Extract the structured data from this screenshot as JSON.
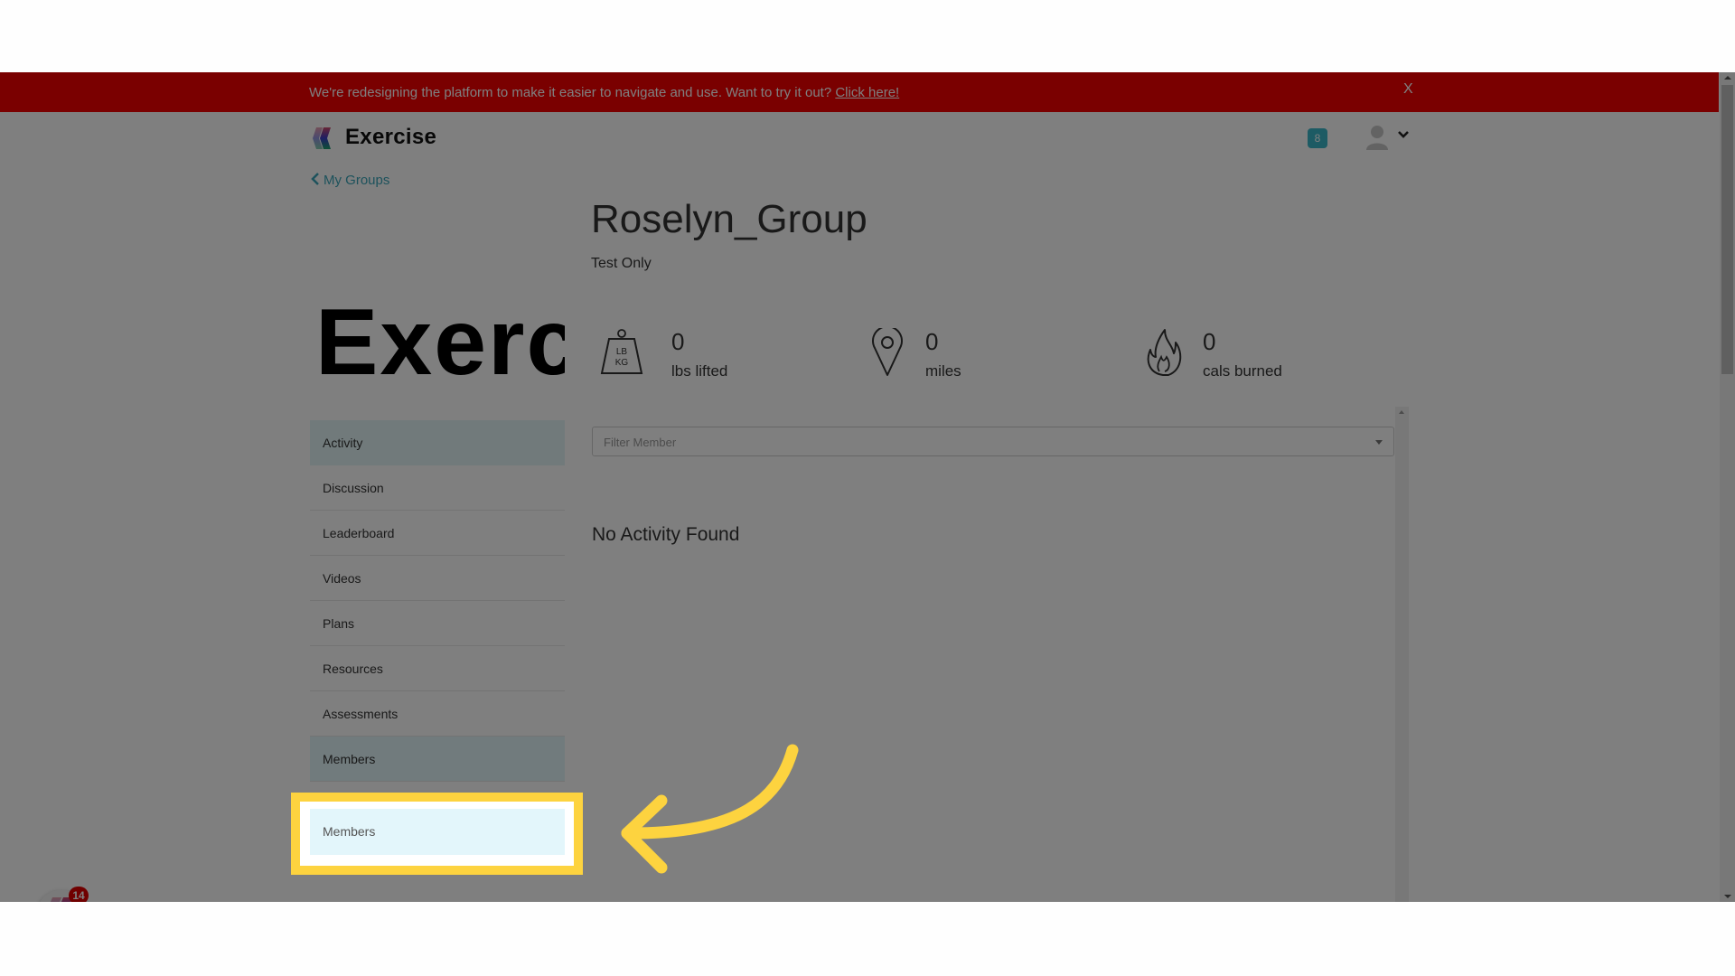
{
  "banner": {
    "message": "We're redesigning the platform to make it easier to navigate and use. Want to try it out?",
    "link_label": "Click here!",
    "close_label": "X",
    "color": "#f40000"
  },
  "header": {
    "brand": "Exercise",
    "notification_count": "8",
    "accent": "#3bb6c9"
  },
  "back_link": {
    "label": "My Groups",
    "icon": "chevron-left-icon"
  },
  "group": {
    "image_text": "Exerc",
    "title": "Roselyn_Group",
    "subtitle": "Test Only"
  },
  "stats": [
    {
      "icon": "weight-icon",
      "icon_text_top": "LB",
      "icon_text_bottom": "KG",
      "value": "0",
      "label": "lbs lifted"
    },
    {
      "icon": "location-pin-icon",
      "value": "0",
      "label": "miles"
    },
    {
      "icon": "flame-icon",
      "value": "0",
      "label": "cals burned"
    }
  ],
  "sidebar": {
    "items": [
      {
        "label": "Activity",
        "active": true
      },
      {
        "label": "Discussion"
      },
      {
        "label": "Leaderboard"
      },
      {
        "label": "Videos"
      },
      {
        "label": "Plans"
      },
      {
        "label": "Resources"
      },
      {
        "label": "Assessments"
      },
      {
        "label": "Members",
        "highlighted": true
      }
    ]
  },
  "filter": {
    "placeholder": "Filter Member"
  },
  "empty_state": "No Activity Found",
  "chat_widget": {
    "badge_count": "14"
  },
  "annotation": {
    "color": "#fdd33f",
    "target": "Members"
  }
}
